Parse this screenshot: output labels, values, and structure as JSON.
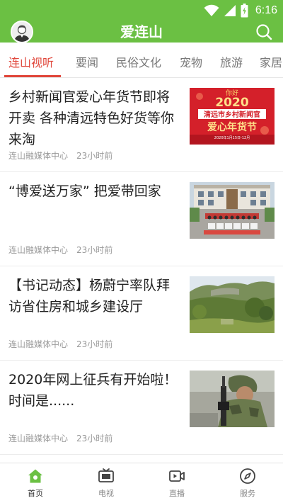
{
  "status_bar": {
    "time": "6:16"
  },
  "header": {
    "title": "爱连山",
    "avatar_icon": "user-avatar-icon",
    "search_icon": "search-icon",
    "brand_color": "#6bc043"
  },
  "tabs": [
    {
      "label": "连山视听",
      "active": true
    },
    {
      "label": "要闻",
      "active": false
    },
    {
      "label": "民俗文化",
      "active": false
    },
    {
      "label": "宠物",
      "active": false
    },
    {
      "label": "旅游",
      "active": false
    },
    {
      "label": "家居",
      "active": false
    }
  ],
  "active_color": "#e0463a",
  "news": [
    {
      "title": "乡村新闻官爱心年货节即将开卖 各种清远特色好货等你来淘",
      "source": "连山融媒体中心",
      "time": "23小时前",
      "thumb": {
        "top": "你好",
        "year": "2020",
        "line1": "清远市乡村新闻官",
        "line2": "爱心年货节",
        "date": "2020年1月15日-12月"
      }
    },
    {
      "title": "“博爱送万家” 把爱带回家",
      "source": "连山融媒体中心",
      "time": "23小时前"
    },
    {
      "title": "【书记动态】杨蔚宁率队拜访省住房和城乡建设厅",
      "source": "连山融媒体中心",
      "time": "23小时前"
    },
    {
      "title": "2020年网上征兵有开始啦！时间是......",
      "source": "连山融媒体中心",
      "time": "23小时前"
    }
  ],
  "bottom_nav": [
    {
      "label": "首页",
      "icon": "home-icon",
      "active": true
    },
    {
      "label": "电视",
      "icon": "tv-icon",
      "active": false
    },
    {
      "label": "直播",
      "icon": "live-video-icon",
      "active": false
    },
    {
      "label": "服务",
      "icon": "compass-icon",
      "active": false
    }
  ]
}
